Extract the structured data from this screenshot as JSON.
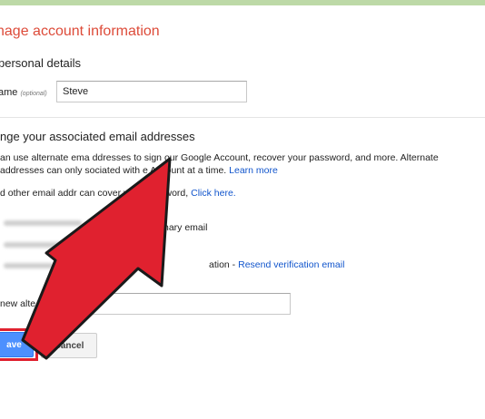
{
  "header": {
    "title": "nage account information"
  },
  "personal": {
    "heading": "personal details",
    "name_label": "ame",
    "name_hint": "(optional)",
    "name_value": "Steve"
  },
  "emails": {
    "heading": "nge your associated email addresses",
    "desc_line1": "an use alternate ema    ddresses to sign    our Google Account, recover your password, and more. Alternate",
    "desc_line2": "addresses can only           sociated with        e Account at a time.",
    "learn_more": "Learn more",
    "other_text": "d other email addr            can              cover your password,",
    "click_here": "Click here.",
    "primary_text": "hary email",
    "verification_text": "ation -",
    "resend_link": "Resend verification email",
    "new_label": "new alte",
    "new_value": ""
  },
  "buttons": {
    "save_label": "ave",
    "cancel_label": "Cancel"
  },
  "colors": {
    "title": "#dd4b39",
    "link": "#1155cc",
    "save": "#4d90fe",
    "arrow": "#e0212f"
  },
  "overlay": {
    "type": "arrow-icon",
    "color": "#e0212f"
  }
}
